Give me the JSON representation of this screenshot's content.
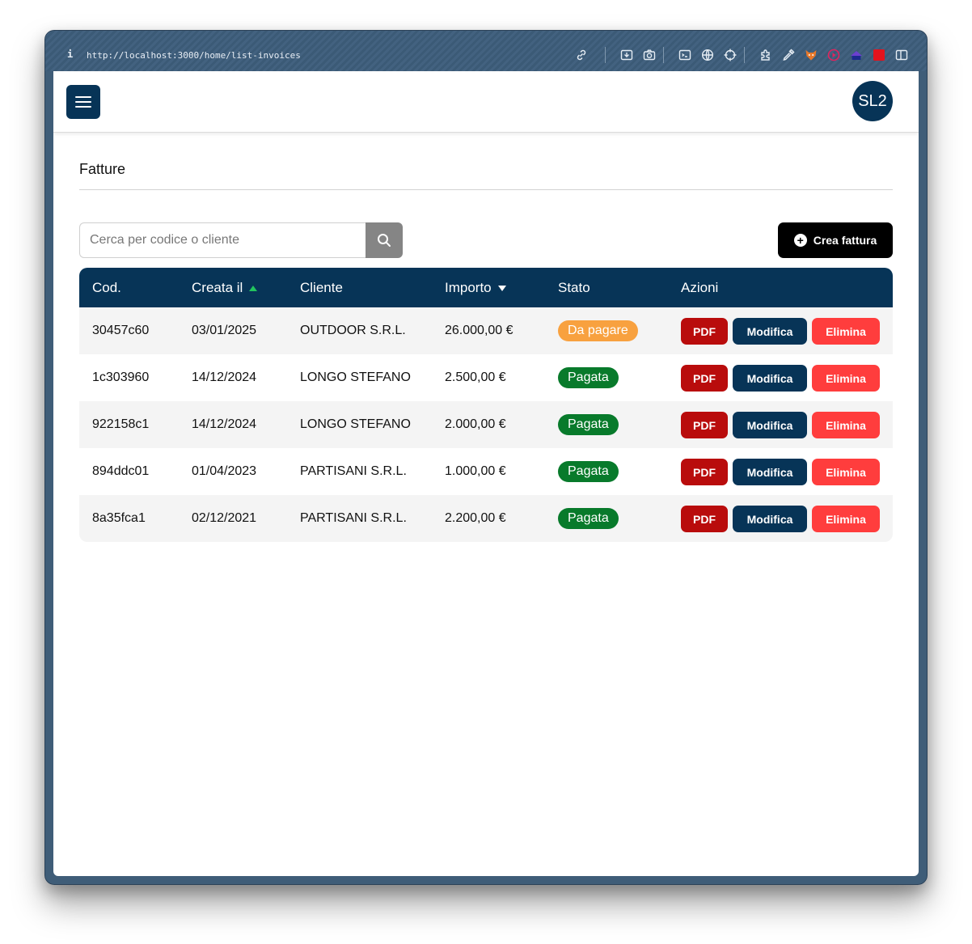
{
  "browser": {
    "info_glyph": "i",
    "url": "http://localhost:3000/home/list-invoices",
    "toolbar_icons": [
      "link-icon",
      "screenshot-save-icon",
      "camera-icon",
      "terminal-icon",
      "globe-icon",
      "crosshair-icon",
      "extension-icon",
      "eyedropper-icon",
      "fox-icon",
      "record-icon",
      "bookmark-icon",
      "red-square-icon",
      "sidebar-icon"
    ]
  },
  "header": {
    "avatar_initials": "SL2"
  },
  "page": {
    "title": "Fatture",
    "search_placeholder": "Cerca per codice o cliente",
    "create_label": "Crea fattura"
  },
  "table": {
    "columns": [
      "Cod.",
      "Creata il",
      "Cliente",
      "Importo",
      "Stato",
      "Azioni"
    ],
    "sort": {
      "created": "asc",
      "amount": "desc"
    },
    "action_labels": {
      "pdf": "PDF",
      "edit": "Modifica",
      "delete": "Elimina"
    },
    "rows": [
      {
        "code": "30457c60",
        "created": "03/01/2025",
        "client": "OUTDOOR S.R.L.",
        "amount": "26.000,00 €",
        "status": "Da pagare",
        "status_kind": "due"
      },
      {
        "code": "1c303960",
        "created": "14/12/2024",
        "client": "LONGO STEFANO",
        "amount": "2.500,00 €",
        "status": "Pagata",
        "status_kind": "paid"
      },
      {
        "code": "922158c1",
        "created": "14/12/2024",
        "client": "LONGO STEFANO",
        "amount": "2.000,00 €",
        "status": "Pagata",
        "status_kind": "paid"
      },
      {
        "code": "894ddc01",
        "created": "01/04/2023",
        "client": "PARTISANI S.R.L.",
        "amount": "1.000,00 €",
        "status": "Pagata",
        "status_kind": "paid"
      },
      {
        "code": "8a35fca1",
        "created": "02/12/2021",
        "client": "PARTISANI S.R.L.",
        "amount": "2.200,00 €",
        "status": "Pagata",
        "status_kind": "paid"
      }
    ]
  },
  "colors": {
    "primary": "#073457",
    "paid": "#087a2b",
    "due": "#f8a13f",
    "pdf": "#b90c0c",
    "delete": "#ff3d3d"
  }
}
